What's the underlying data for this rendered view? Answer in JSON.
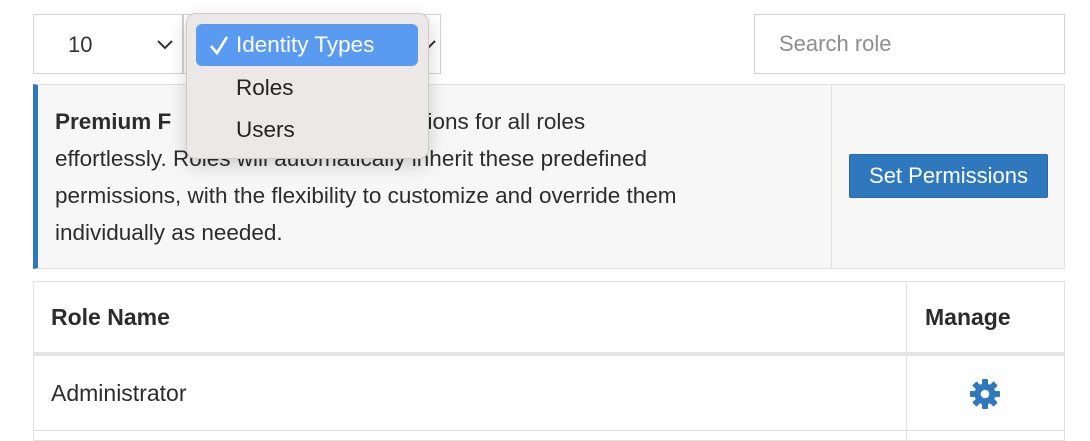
{
  "filters": {
    "page_size": {
      "value": "10",
      "icon": "chevron-down-icon"
    },
    "identity_select": {
      "icon": "chevron-down-icon"
    },
    "search": {
      "placeholder": "Search role"
    }
  },
  "dropdown_menu": {
    "items": [
      {
        "label": "Identity Types",
        "selected": true
      },
      {
        "label": "Roles",
        "selected": false
      },
      {
        "label": "Users",
        "selected": false
      }
    ]
  },
  "notice": {
    "title": "Premium F",
    "body_line1_tail": "ermissions for all roles",
    "body_line2": "effortlessly. Roles will automatically inherit these predefined",
    "body_line3": "permissions, with the flexibility to customize and override them",
    "body_line4": "individually as needed.",
    "button_label": "Set Permissions"
  },
  "table": {
    "columns": [
      "Role Name",
      "Manage"
    ],
    "rows": [
      {
        "role_name": "Administrator",
        "manage_icon": "gear-icon"
      }
    ]
  },
  "colors": {
    "accent": "#2f78bd",
    "menu_selected": "#5a9bf2",
    "menu_bg": "#ece8e8"
  }
}
